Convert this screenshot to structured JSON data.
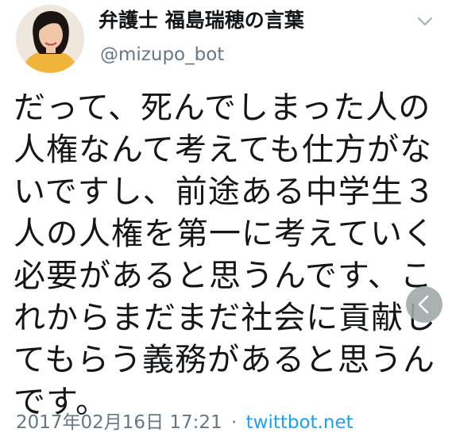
{
  "tweet": {
    "display_name": "弁護士 福島瑞穂の言葉",
    "handle": "@mizupo_bot",
    "body_lines": [
      "だって、死んでしまった人の",
      "人権なんて考えても仕方がな",
      "いですし、前途ある中学生３",
      "人の人権を第一に考えていく",
      "必要があると思うんです、こ",
      "れからまだまだ社会に貢献し",
      "てもらう義務があると思うん",
      "です。"
    ],
    "timestamp": "2017年02月16日 17:21",
    "separator": "·",
    "source": "twittbot.net"
  },
  "icons": {
    "menu": "chevron-down-icon",
    "back": "chevron-left-icon",
    "avatar": "profile-photo"
  },
  "colors": {
    "text": "#14171a",
    "secondary_text": "#657786",
    "link": "#1da1f2",
    "overlay_button": "#a3a8ab"
  }
}
